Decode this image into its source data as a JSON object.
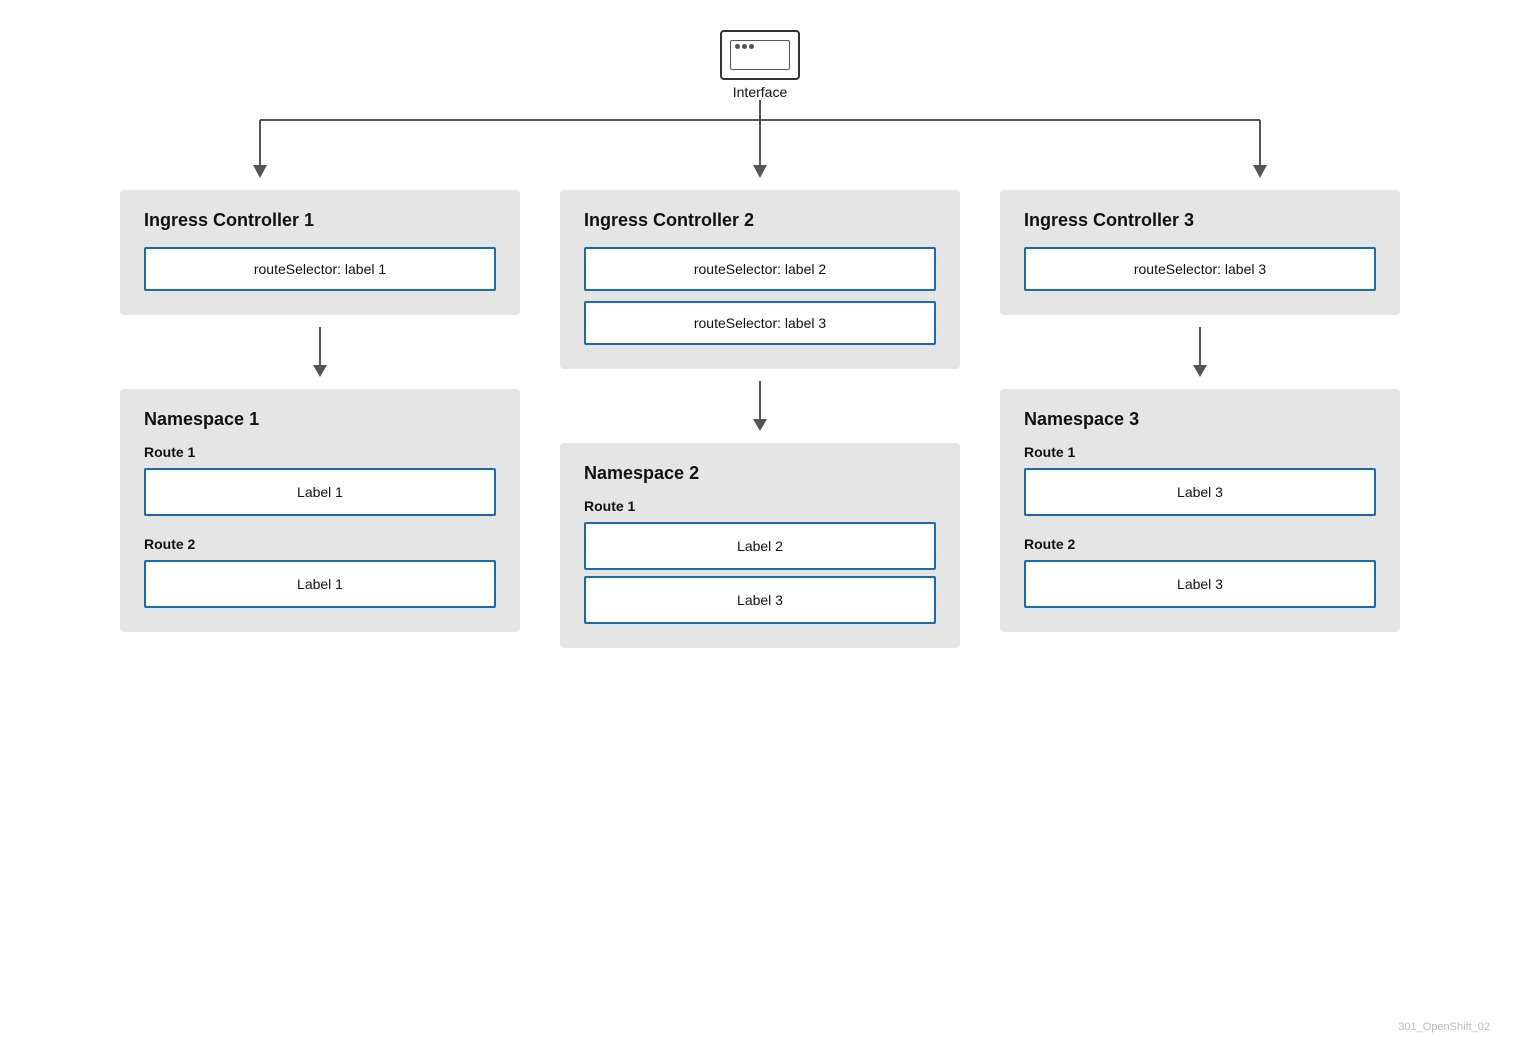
{
  "interface": {
    "label": "Interface"
  },
  "columns": [
    {
      "id": "col1",
      "ingress": {
        "title": "Ingress Controller 1",
        "routeSelectors": [
          {
            "text": "routeSelector: label 1"
          }
        ]
      },
      "namespace": {
        "title": "Namespace 1",
        "routes": [
          {
            "title": "Route 1",
            "labels": [
              "Label 1"
            ]
          },
          {
            "title": "Route 2",
            "labels": [
              "Label 1"
            ]
          }
        ]
      }
    },
    {
      "id": "col2",
      "ingress": {
        "title": "Ingress Controller 2",
        "routeSelectors": [
          {
            "text": "routeSelector: label 2"
          },
          {
            "text": "routeSelector: label 3"
          }
        ]
      },
      "namespace": {
        "title": "Namespace 2",
        "routes": [
          {
            "title": "Route 1",
            "labels": [
              "Label 2",
              "Label 3"
            ]
          }
        ]
      }
    },
    {
      "id": "col3",
      "ingress": {
        "title": "Ingress Controller 3",
        "routeSelectors": [
          {
            "text": "routeSelector: label 3"
          }
        ]
      },
      "namespace": {
        "title": "Namespace 3",
        "routes": [
          {
            "title": "Route 1",
            "labels": [
              "Label 3"
            ]
          },
          {
            "title": "Route 2",
            "labels": [
              "Label 3"
            ]
          }
        ]
      }
    }
  ],
  "watermark": "301_OpenShift_02"
}
